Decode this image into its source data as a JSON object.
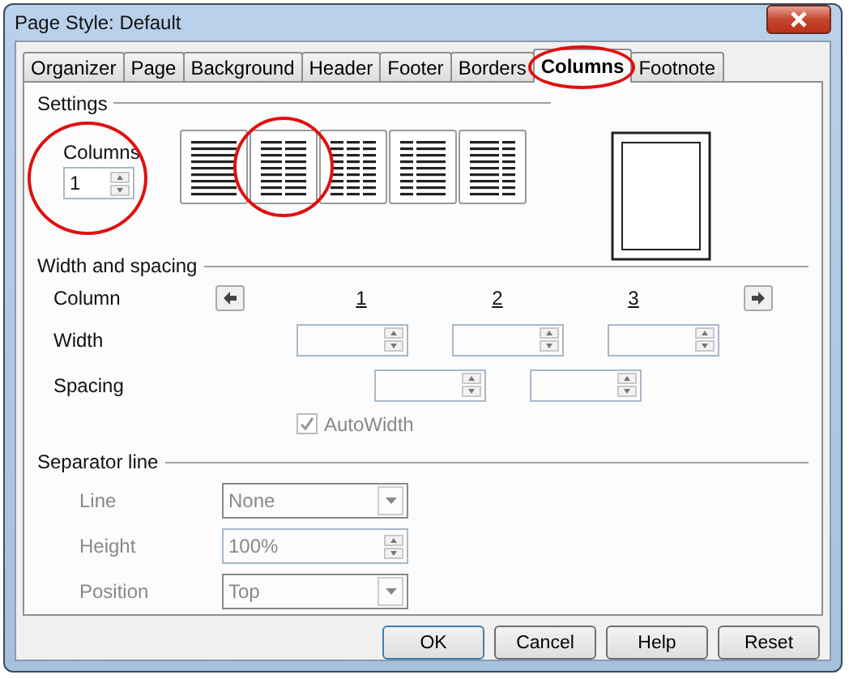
{
  "window": {
    "title": "Page Style: Default"
  },
  "tabs": [
    {
      "label": "Organizer",
      "selected": false
    },
    {
      "label": "Page",
      "selected": false
    },
    {
      "label": "Background",
      "selected": false
    },
    {
      "label": "Header",
      "selected": false
    },
    {
      "label": "Footer",
      "selected": false
    },
    {
      "label": "Borders",
      "selected": false
    },
    {
      "label": "Columns",
      "selected": true
    },
    {
      "label": "Footnote",
      "selected": false
    }
  ],
  "settings": {
    "heading": "Settings",
    "columns_label": "Columns",
    "columns_value": "1",
    "presets": [
      {
        "kind": "one"
      },
      {
        "kind": "two"
      },
      {
        "kind": "three"
      },
      {
        "kind": "left"
      },
      {
        "kind": "right"
      }
    ]
  },
  "width_spacing": {
    "heading": "Width and spacing",
    "column_label": "Column",
    "width_label": "Width",
    "spacing_label": "Spacing",
    "column_numbers": [
      "1",
      "2",
      "3"
    ],
    "autowidth": {
      "label": "AutoWidth",
      "checked": true,
      "disabled": true
    }
  },
  "separator": {
    "heading": "Separator line",
    "fields": [
      {
        "label": "Line",
        "kind": "dropdown",
        "value": "None"
      },
      {
        "label": "Height",
        "kind": "spinner",
        "value": "100%"
      },
      {
        "label": "Position",
        "kind": "dropdown",
        "value": "Top"
      }
    ]
  },
  "buttons": [
    {
      "label": "OK",
      "default": true
    },
    {
      "label": "Cancel",
      "default": false
    },
    {
      "label": "Help",
      "default": false
    },
    {
      "label": "Reset",
      "default": false
    }
  ]
}
